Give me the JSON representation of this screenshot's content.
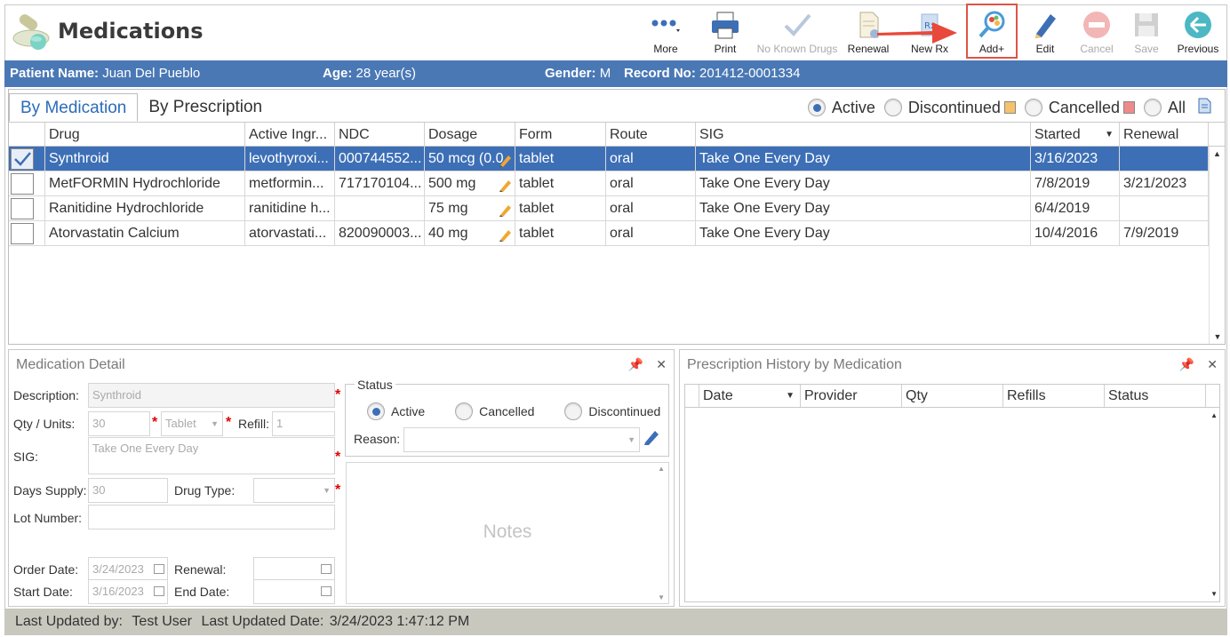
{
  "app": {
    "title": "Medications"
  },
  "toolbar": {
    "more": "More",
    "print": "Print",
    "no_known_drugs": "No Known Drugs",
    "renewal": "Renewal",
    "new_rx": "New Rx",
    "add": "Add+",
    "edit": "Edit",
    "cancel": "Cancel",
    "save": "Save",
    "previous": "Previous"
  },
  "patient": {
    "name_label": "Patient Name:",
    "name": "Juan Del Pueblo",
    "age_label": "Age:",
    "age": "28 year(s)",
    "gender_label": "Gender:",
    "gender": "M",
    "record_label": "Record No:",
    "record": "201412-0001334"
  },
  "tabs": [
    "By Medication",
    "By Prescription"
  ],
  "filters": {
    "active": "Active",
    "discontinued": "Discontinued",
    "cancelled": "Cancelled",
    "all": "All",
    "selected": "Active",
    "discontinued_color": "#f5c26b",
    "cancelled_color": "#f08a8a"
  },
  "table": {
    "columns": [
      "Drug",
      "Active Ingr...",
      "NDC",
      "Dosage",
      "Form",
      "Route",
      "SIG",
      "Started",
      "Renewal"
    ],
    "rows": [
      {
        "checked": true,
        "drug": "Synthroid",
        "ingr": "levothyroxi...",
        "ndc": "000744552...",
        "dosage": "50 mcg (0.0",
        "form": "tablet",
        "route": "oral",
        "sig": "Take One Every Day",
        "started": "3/16/2023",
        "renewal": ""
      },
      {
        "checked": false,
        "drug": "MetFORMIN Hydrochloride",
        "ingr": "metformin...",
        "ndc": "717170104...",
        "dosage": "500 mg",
        "form": "tablet",
        "route": "oral",
        "sig": "Take One Every Day",
        "started": "7/8/2019",
        "renewal": "3/21/2023"
      },
      {
        "checked": false,
        "drug": "Ranitidine Hydrochloride",
        "ingr": "ranitidine h...",
        "ndc": "",
        "dosage": "75 mg",
        "form": "tablet",
        "route": "oral",
        "sig": "Take One Every Day",
        "started": "6/4/2019",
        "renewal": ""
      },
      {
        "checked": false,
        "drug": "Atorvastatin Calcium",
        "ingr": "atorvastati...",
        "ndc": "820090003...",
        "dosage": "40 mg",
        "form": "tablet",
        "route": "oral",
        "sig": "Take One Every Day",
        "started": "10/4/2016",
        "renewal": "7/9/2019"
      }
    ]
  },
  "detail": {
    "title": "Medication Detail",
    "description_label": "Description:",
    "description": "Synthroid",
    "qty_label": "Qty / Units:",
    "qty": "30",
    "units": "Tablet",
    "refill_label": "Refill:",
    "refill": "1",
    "sig_label": "SIG:",
    "sig": "Take One Every Day",
    "days_label": "Days Supply:",
    "days": "30",
    "drugtype_label": "Drug Type:",
    "lot_label": "Lot Number:",
    "order_label": "Order Date:",
    "order_date": "3/24/2023",
    "renewal_label": "Renewal:",
    "start_label": "Start Date:",
    "start_date": "3/16/2023",
    "end_label": "End Date:",
    "status_title": "Status",
    "status_active": "Active",
    "status_cancelled": "Cancelled",
    "status_discontinued": "Discontinued",
    "reason_label": "Reason:",
    "notes_placeholder": "Notes"
  },
  "history": {
    "title": "Prescription History by Medication",
    "columns": [
      "Date",
      "Provider",
      "Qty",
      "Refills",
      "Status"
    ]
  },
  "footer": {
    "updated_by_label": "Last Updated by:",
    "updated_by": "Test User",
    "updated_date_label": "Last Updated Date:",
    "updated_date": "3/24/2023 1:47:12 PM"
  }
}
